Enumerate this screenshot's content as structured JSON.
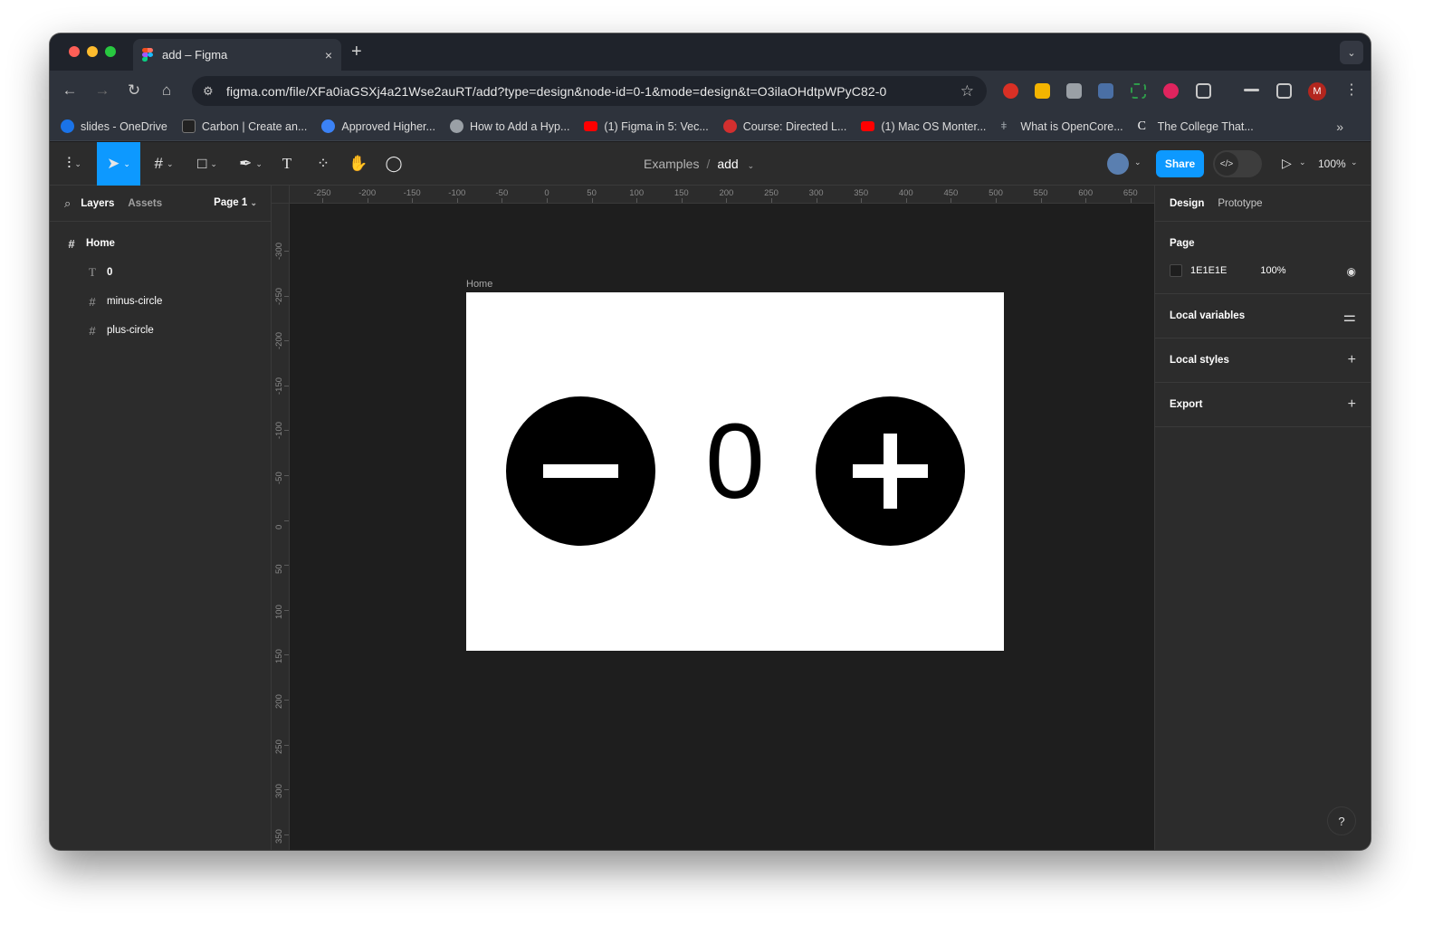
{
  "browser": {
    "tab_title": "add – Figma",
    "tab_close": "×",
    "new_tab": "+",
    "tab_menu": "⌄",
    "url": "figma.com/file/XFa0iaGSXj4a21Wse2auRT/add?type=design&node-id=0-1&mode=design&t=O3ilaOHdtpWPyC82-0",
    "profile_initial": "M",
    "bookmarks": [
      {
        "label": "slides - OneDrive",
        "color": "#1a73e8"
      },
      {
        "label": "Carbon | Create an...",
        "color": "#222222"
      },
      {
        "label": "Approved Higher...",
        "color": "#3b82f6"
      },
      {
        "label": "How to Add a Hyp...",
        "color": "#9aa0a6"
      },
      {
        "label": "(1) Figma in 5: Vec...",
        "color": "#ff0000"
      },
      {
        "label": "Course: Directed L...",
        "color": "#d32f2f"
      },
      {
        "label": "(1) Mac OS Monter...",
        "color": "#ff0000"
      },
      {
        "label": "What is OpenCore...",
        "color": "#9aa0a6"
      },
      {
        "label": "The College That...",
        "color": "#ffffff"
      }
    ],
    "bookmarks_more": "»"
  },
  "figma": {
    "breadcrumb_project": "Examples",
    "breadcrumb_sep": "/",
    "file_name": "add",
    "share_label": "Share",
    "dev_mode_icon": "</>",
    "zoom": "100%",
    "accent": "#0d99ff"
  },
  "left_panel": {
    "tab_layers": "Layers",
    "tab_assets": "Assets",
    "page_selector": "Page 1",
    "layers": [
      {
        "name": "Home",
        "type": "frame"
      },
      {
        "name": "0",
        "type": "text"
      },
      {
        "name": "minus-circle",
        "type": "frame"
      },
      {
        "name": "plus-circle",
        "type": "frame"
      }
    ]
  },
  "right_panel": {
    "tab_design": "Design",
    "tab_prototype": "Prototype",
    "page_heading": "Page",
    "page_color": "1E1E1E",
    "page_opacity": "100%",
    "local_variables": "Local variables",
    "local_styles": "Local styles",
    "export": "Export",
    "help": "?"
  },
  "canvas": {
    "frame_name": "Home",
    "counter_value": "0",
    "ruler_x": [
      "-250",
      "-200",
      "-150",
      "-100",
      "-50",
      "0",
      "50",
      "100",
      "150",
      "200",
      "250",
      "300",
      "350",
      "400",
      "450",
      "500",
      "550",
      "600",
      "650"
    ],
    "ruler_y": [
      "-300",
      "-250",
      "-200",
      "-150",
      "-100",
      "-50",
      "0",
      "50",
      "100",
      "150",
      "200",
      "250",
      "300",
      "350"
    ]
  }
}
